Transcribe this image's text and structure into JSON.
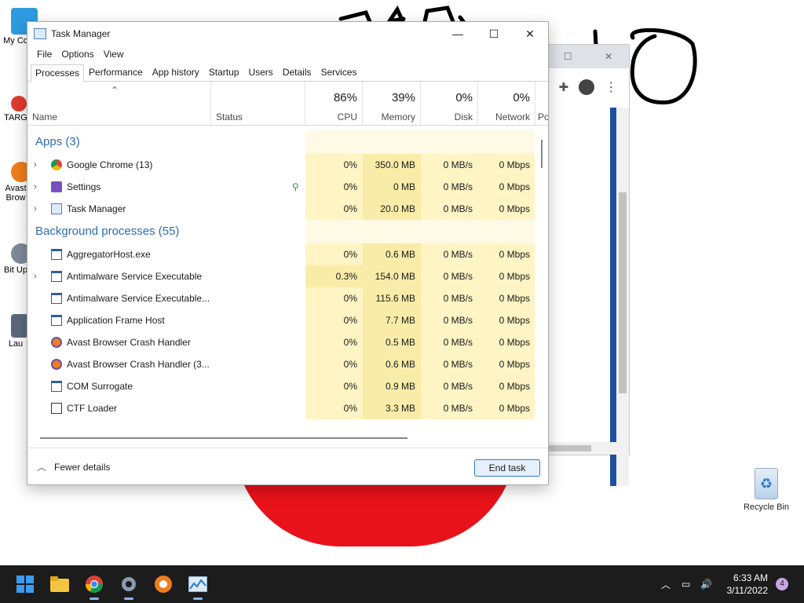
{
  "desktop": {
    "icons": [
      {
        "label": "My Co",
        "name": "this-pc"
      },
      {
        "label": "TARG",
        "name": "target-app"
      },
      {
        "label": "Avast Brow",
        "name": "avast-browser"
      },
      {
        "label": "Bit Up",
        "name": "bit-updater"
      },
      {
        "label": "Lau",
        "name": "launcher"
      }
    ],
    "recycle_bin": "Recycle Bin"
  },
  "task_manager": {
    "title": "Task Manager",
    "menu": [
      "File",
      "Options",
      "View"
    ],
    "tabs": [
      "Processes",
      "Performance",
      "App history",
      "Startup",
      "Users",
      "Details",
      "Services"
    ],
    "active_tab": "Processes",
    "columns": {
      "name": "Name",
      "status": "Status",
      "cpu": {
        "pct": "86%",
        "label": "CPU"
      },
      "memory": {
        "pct": "39%",
        "label": "Memory"
      },
      "disk": {
        "pct": "0%",
        "label": "Disk"
      },
      "network": {
        "pct": "0%",
        "label": "Network"
      },
      "power": "Po"
    },
    "groups": {
      "apps": "Apps (3)",
      "background": "Background processes (55)"
    },
    "apps": [
      {
        "name": "Google Chrome (13)",
        "cpu": "0%",
        "memory": "350.0 MB",
        "disk": "0 MB/s",
        "network": "0 Mbps",
        "expandable": true
      },
      {
        "name": "Settings",
        "cpu": "0%",
        "memory": "0 MB",
        "disk": "0 MB/s",
        "network": "0 Mbps",
        "expandable": true,
        "status_icon": "leaf-icon"
      },
      {
        "name": "Task Manager",
        "cpu": "0%",
        "memory": "20.0 MB",
        "disk": "0 MB/s",
        "network": "0 Mbps",
        "expandable": true
      }
    ],
    "background": [
      {
        "name": "AggregatorHost.exe",
        "cpu": "0%",
        "memory": "0.6 MB",
        "disk": "0 MB/s",
        "network": "0 Mbps",
        "expandable": false
      },
      {
        "name": "Antimalware Service Executable",
        "cpu": "0.3%",
        "memory": "154.0 MB",
        "disk": "0 MB/s",
        "network": "0 Mbps",
        "expandable": true
      },
      {
        "name": "Antimalware Service Executable...",
        "cpu": "0%",
        "memory": "115.6 MB",
        "disk": "0 MB/s",
        "network": "0 Mbps",
        "expandable": false
      },
      {
        "name": "Application Frame Host",
        "cpu": "0%",
        "memory": "7.7 MB",
        "disk": "0 MB/s",
        "network": "0 Mbps",
        "expandable": false
      },
      {
        "name": "Avast Browser Crash Handler",
        "cpu": "0%",
        "memory": "0.5 MB",
        "disk": "0 MB/s",
        "network": "0 Mbps",
        "expandable": false
      },
      {
        "name": "Avast Browser Crash Handler (3...",
        "cpu": "0%",
        "memory": "0.6 MB",
        "disk": "0 MB/s",
        "network": "0 Mbps",
        "expandable": false
      },
      {
        "name": "COM Surrogate",
        "cpu": "0%",
        "memory": "0.9 MB",
        "disk": "0 MB/s",
        "network": "0 Mbps",
        "expandable": false
      },
      {
        "name": "CTF Loader",
        "cpu": "0%",
        "memory": "3.3 MB",
        "disk": "0 MB/s",
        "network": "0 Mbps",
        "expandable": false
      }
    ],
    "footer": {
      "fewer_details": "Fewer details",
      "end_task": "End task"
    }
  },
  "taskbar": {
    "apps": [
      "start-icon",
      "file-explorer-icon",
      "chrome-icon",
      "settings-icon",
      "avast-browser-icon",
      "task-manager-icon"
    ],
    "active_app": "task-manager-icon",
    "time": "6:33 AM",
    "date": "3/11/2022",
    "notification_count": "4"
  },
  "colors": {
    "group_header": "#2f6cb0",
    "heat_light": "#fff4c4",
    "heat_medium": "#f9eca8",
    "taskbar": "#1c1c1c",
    "accent": "#2a79d0"
  }
}
